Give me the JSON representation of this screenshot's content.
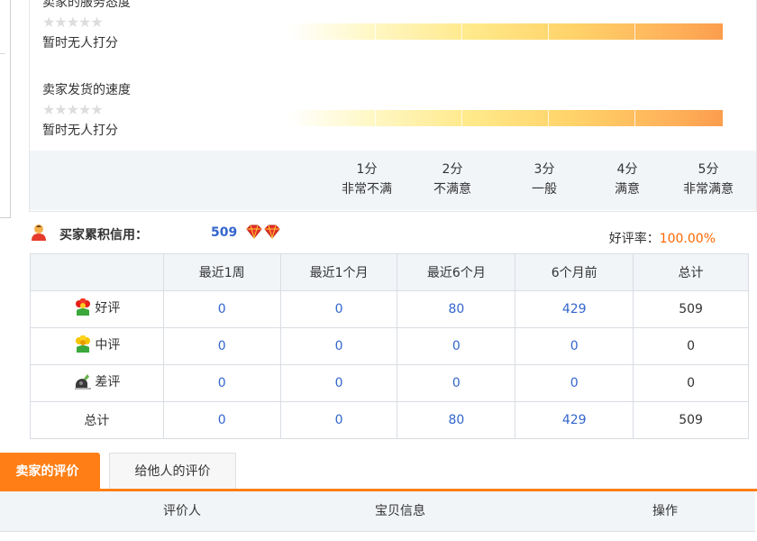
{
  "ratings": [
    {
      "title": "卖家的服务态度",
      "stars": "★★★★★",
      "status": "暂时无人打分"
    },
    {
      "title": "卖家发货的速度",
      "stars": "★★★★★",
      "status": "暂时无人打分"
    }
  ],
  "scale": [
    {
      "score": "1分",
      "desc": "非常不满"
    },
    {
      "score": "2分",
      "desc": "不满意"
    },
    {
      "score": "3分",
      "desc": "一般"
    },
    {
      "score": "4分",
      "desc": "满意"
    },
    {
      "score": "5分",
      "desc": "非常满意"
    }
  ],
  "credit": {
    "label": "买家累积信用：",
    "value": "509",
    "rate_label": "好评率：",
    "rate_value": "100.00%"
  },
  "stats": {
    "headers": [
      "",
      "最近1周",
      "最近1个月",
      "最近6个月",
      "6个月前",
      "总计"
    ],
    "rows": [
      {
        "label": "好评",
        "icon": "red-flower-icon",
        "values": [
          "0",
          "0",
          "80",
          "429",
          "509"
        ]
      },
      {
        "label": "中评",
        "icon": "yellow-flower-icon",
        "values": [
          "0",
          "0",
          "0",
          "0",
          "0"
        ]
      },
      {
        "label": "差评",
        "icon": "bad-review-icon",
        "values": [
          "0",
          "0",
          "0",
          "0",
          "0"
        ]
      },
      {
        "label": "总计",
        "icon": "",
        "values": [
          "0",
          "0",
          "80",
          "429",
          "509"
        ]
      }
    ]
  },
  "tabs": {
    "active": "卖家的评价",
    "other": "给他人的评价"
  },
  "list_headers": {
    "reviewer": "评价人",
    "item": "宝贝信息",
    "action": "操作"
  },
  "colors": {
    "accent": "#ff7f16",
    "link_blue": "#3366cc",
    "rate_orange": "#ff6600"
  }
}
